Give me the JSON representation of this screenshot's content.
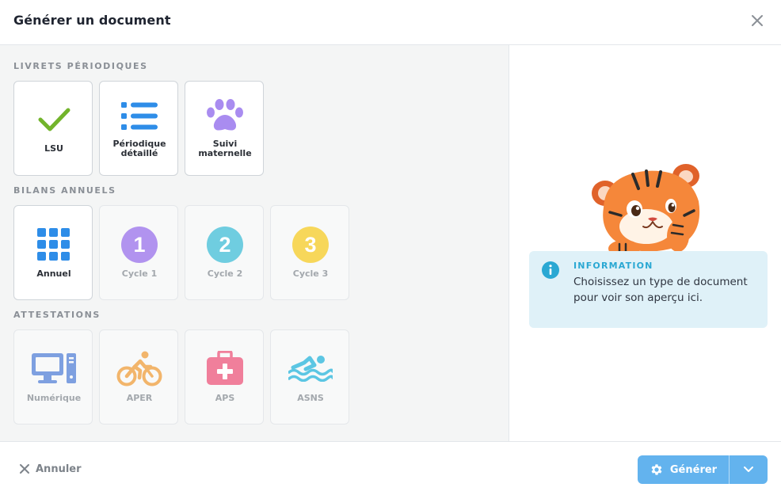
{
  "dialog": {
    "title": "Générer un document",
    "close_icon": "close-icon"
  },
  "sections": [
    {
      "title": "LIVRETS PÉRIODIQUES",
      "cards": [
        {
          "label": "LSU",
          "icon": "checkmark-icon",
          "color": "#72b42b",
          "active": true
        },
        {
          "label": "Périodique\ndétaillé",
          "icon": "list-icon",
          "color": "#2e8de8",
          "active": true
        },
        {
          "label": "Suivi\nmaternelle",
          "icon": "paw-icon",
          "color": "#a98cf0",
          "active": true
        }
      ]
    },
    {
      "title": "BILANS ANNUELS",
      "cards": [
        {
          "label": "Annuel",
          "icon": "grid-icon",
          "color": "#2e8de8",
          "active": true
        },
        {
          "label": "Cycle 1",
          "icon": "number-1-icon",
          "color": "#b193ef",
          "active": false
        },
        {
          "label": "Cycle 2",
          "icon": "number-2-icon",
          "color": "#6fcde0",
          "active": false
        },
        {
          "label": "Cycle 3",
          "icon": "number-3-icon",
          "color": "#f7d75a",
          "active": false
        }
      ]
    },
    {
      "title": "ATTESTATIONS",
      "cards": [
        {
          "label": "Numérique",
          "icon": "computer-icon",
          "color": "#7ea0e0",
          "active": false
        },
        {
          "label": "APER",
          "icon": "bicycle-icon",
          "color": "#f2b56b",
          "active": false
        },
        {
          "label": "APS",
          "icon": "first-aid-kit-icon",
          "color": "#f07f9b",
          "active": false
        },
        {
          "label": "ASNS",
          "icon": "swimmer-icon",
          "color": "#5cc6e3",
          "active": false
        }
      ]
    }
  ],
  "info": {
    "title": "INFORMATION",
    "text": "Choisissez un type de document pour voir son aperçu ici.",
    "accent": "#2aa8d3",
    "background": "#dff1f8"
  },
  "footer": {
    "cancel_label": "Annuler",
    "generate_label": "Générer",
    "generate_color": "#63b3ee"
  }
}
